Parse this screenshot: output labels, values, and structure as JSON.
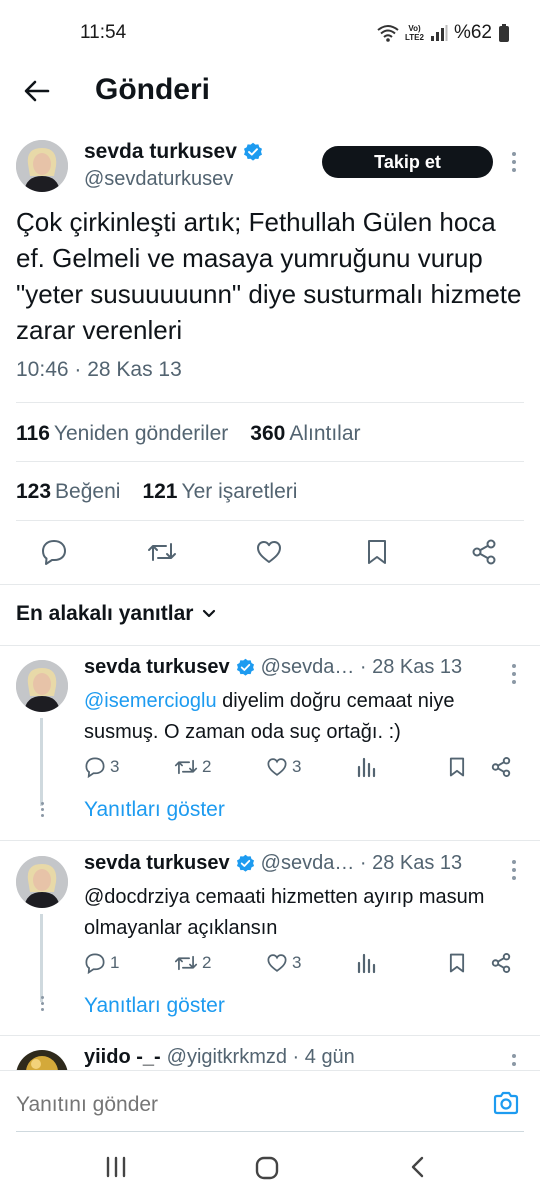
{
  "status_bar": {
    "time": "11:54",
    "network_line1": "Vo)",
    "network_line2": "LTE2",
    "battery": "%62"
  },
  "header": {
    "title": "Gönderi"
  },
  "post": {
    "author_name": "sevda turkusev",
    "author_handle": "@sevdaturkusev",
    "follow_label": "Takip et",
    "text": "Çok çirkinleşti artık; Fethullah Gülen hoca ef. Gelmeli ve masaya yumruğunu vurup \"yeter susuuuuunn\" diye susturmalı hizmete zarar verenleri",
    "timestamp": "10:46 · 28 Kas 13",
    "reposts_count": "116",
    "reposts_label": "Yeniden gönderiler",
    "quotes_count": "360",
    "quotes_label": "Alıntılar",
    "likes_count": "123",
    "likes_label": "Beğeni",
    "bookmarks_count": "121",
    "bookmarks_label": "Yer işaretleri"
  },
  "replies_header": {
    "sort_label": "En alakalı yanıtlar"
  },
  "replies": [
    {
      "author_name": "sevda turkusev",
      "handle_date": "@sevda… · 28 Kas 13",
      "mention": "@isemercioglu",
      "text": " diyelim doğru cemaat niye susmuş. O zaman oda suç ortağı. :)",
      "reply_count": "3",
      "repost_count": "2",
      "like_count": "3",
      "show_replies": "Yanıtları göster"
    },
    {
      "author_name": "sevda turkusev",
      "handle_date": "@sevda… · 28 Kas 13",
      "mention": "",
      "text": "@docdrziya  cemaati hizmetten ayırıp masum olmayanlar açıklansın",
      "reply_count": "1",
      "repost_count": "2",
      "like_count": "3",
      "show_replies": "Yanıtları göster"
    },
    {
      "author_name": "yiido -_-",
      "handle_date": "@yigitkrkmzd · 4 gün"
    }
  ],
  "compose": {
    "placeholder": "Yanıtını gönder"
  },
  "colors": {
    "accent": "#1d9bf0",
    "text": "#0f1419",
    "muted": "#536471",
    "verified": "#1d9bf0"
  },
  "icons": {
    "back": "arrow-left-icon",
    "verified": "verified-badge-icon",
    "reply": "reply-icon",
    "repost": "repost-icon",
    "like": "heart-icon",
    "bookmark": "bookmark-icon",
    "share": "share-icon",
    "views": "views-icon",
    "camera": "camera-icon"
  }
}
